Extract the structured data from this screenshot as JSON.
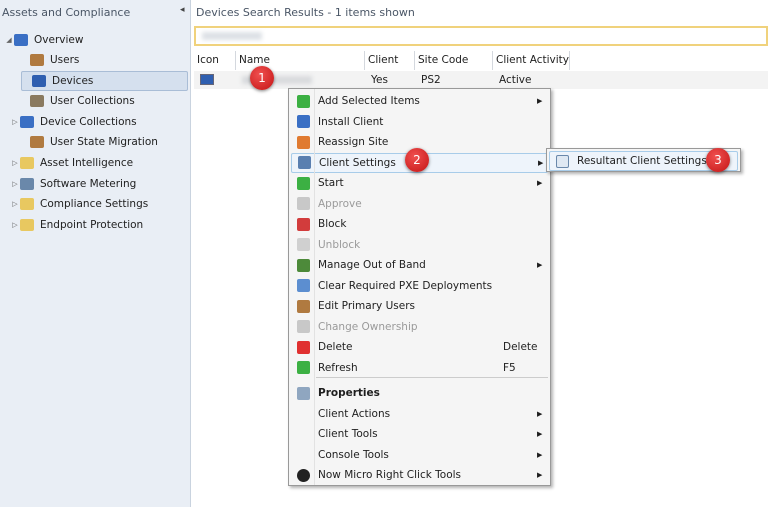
{
  "sidebar": {
    "title": "Assets and Compliance",
    "items": [
      {
        "label": "Overview",
        "icon": "overview-icon",
        "expander": "◢"
      },
      {
        "label": "Users",
        "icon": "user-icon"
      },
      {
        "label": "Devices",
        "icon": "devices-icon"
      },
      {
        "label": "User Collections",
        "icon": "user-collections-icon"
      },
      {
        "label": "Device Collections",
        "icon": "device-collections-icon",
        "expander": "▷"
      },
      {
        "label": "User State Migration",
        "icon": "user-state-icon"
      },
      {
        "label": "Asset Intelligence",
        "icon": "folder-icon",
        "expander": "▷"
      },
      {
        "label": "Software Metering",
        "icon": "metering-icon",
        "expander": "▷"
      },
      {
        "label": "Compliance Settings",
        "icon": "folder-icon",
        "expander": "▷"
      },
      {
        "label": "Endpoint Protection",
        "icon": "folder-icon",
        "expander": "▷"
      }
    ]
  },
  "main": {
    "title": "Devices Search Results  -  1 items shown",
    "columns": [
      "Icon",
      "Name",
      "Client",
      "Site Code",
      "Client Activity"
    ],
    "row": {
      "client": "Yes",
      "site_code": "PS2",
      "activity": "Active"
    }
  },
  "badges": [
    "1",
    "2",
    "3"
  ],
  "menu": {
    "items": [
      {
        "label": "Add Selected Items",
        "arrow": "▶",
        "color": "#3cb043"
      },
      {
        "label": "Install Client",
        "color": "#3a6fc4"
      },
      {
        "label": "Reassign Site",
        "color": "#e07a30"
      },
      {
        "label": "Client Settings",
        "arrow": "▶",
        "color": "#5a7fb0"
      },
      {
        "label": "Start",
        "arrow": "▶",
        "color": "#3cb043"
      },
      {
        "label": "Approve",
        "disabled": true,
        "color": "#c8c8c8"
      },
      {
        "label": "Block",
        "color": "#d23c3c"
      },
      {
        "label": "Unblock",
        "disabled": true,
        "color": "#d0d0d0"
      },
      {
        "label": "Manage Out of Band",
        "arrow": "▶",
        "color": "#4d8a3a"
      },
      {
        "label": "Clear Required PXE Deployments",
        "color": "#5c8ed0"
      },
      {
        "label": "Edit Primary Users",
        "color": "#b07a40"
      },
      {
        "label": "Change Ownership",
        "disabled": true,
        "color": "#c8c8c8"
      },
      {
        "label": "Delete",
        "shortcut": "Delete",
        "color": "#e03030"
      },
      {
        "label": "Refresh",
        "shortcut": "F5",
        "color": "#3cb043"
      },
      {
        "label": "Properties",
        "bold": true,
        "color": "#8fa6c0"
      },
      {
        "label": "Client Actions",
        "arrow": "▶"
      },
      {
        "label": "Client Tools",
        "arrow": "▶"
      },
      {
        "label": "Console Tools",
        "arrow": "▶"
      },
      {
        "label": "Now Micro Right Click Tools",
        "arrow": "▶",
        "color": "#222222"
      }
    ]
  },
  "submenu": {
    "label": "Resultant Client Settings"
  }
}
